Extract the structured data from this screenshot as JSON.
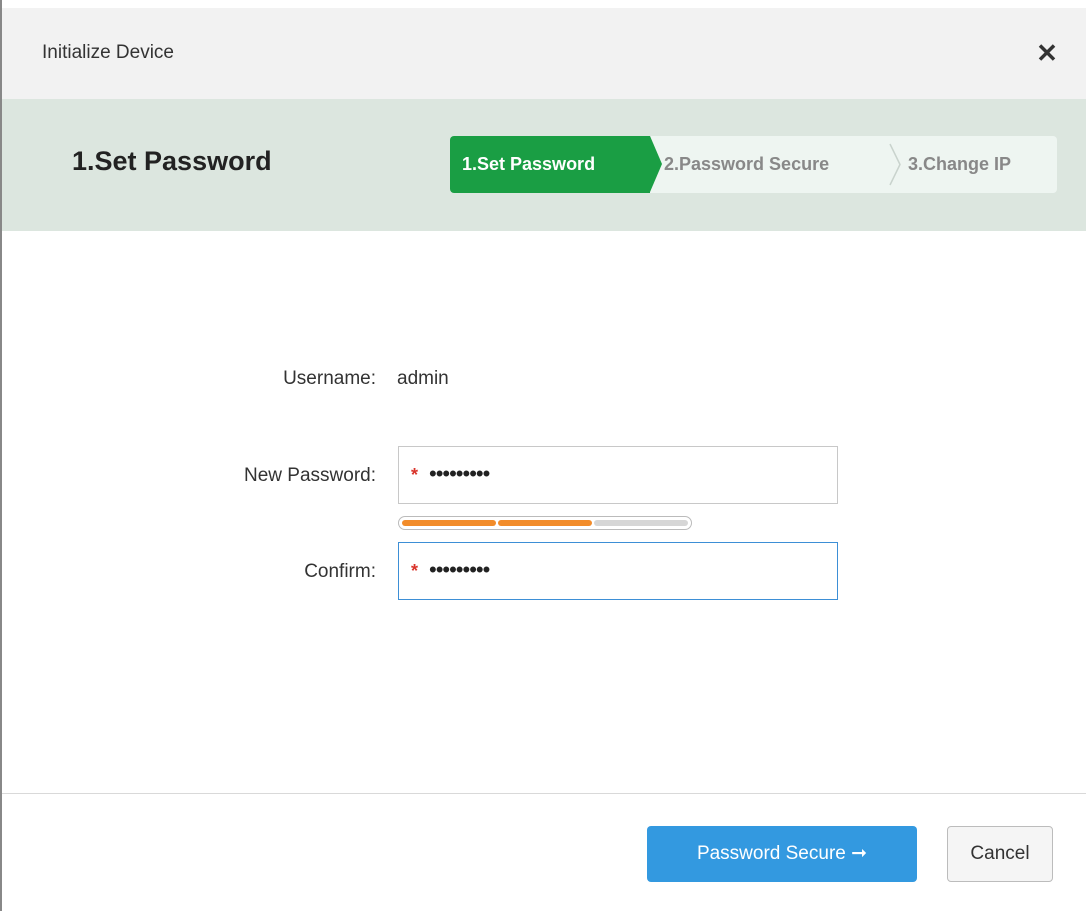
{
  "dialog": {
    "title": "Initialize Device",
    "close_icon": "close-icon"
  },
  "stepbar": {
    "heading": "1.Set Password",
    "steps": [
      {
        "label": "1.Set Password",
        "active": true
      },
      {
        "label": "2.Password Secure",
        "active": false
      },
      {
        "label": "3.Change IP",
        "active": false
      }
    ]
  },
  "form": {
    "username_label": "Username:",
    "username_value": "admin",
    "new_password_label": "New Password:",
    "new_password_mask": "•••••••••",
    "confirm_label": "Confirm:",
    "confirm_mask": "•••••••••",
    "required_mark": "*",
    "strength_level": 0.67
  },
  "footer": {
    "primary_label": "Password Secure ➞",
    "cancel_label": "Cancel"
  },
  "colors": {
    "active_step": "#1a9e44",
    "primary_button": "#3399e0",
    "strength_filled": "#f28c2a",
    "strength_empty": "#d6d6d6",
    "required": "#d9342b"
  }
}
